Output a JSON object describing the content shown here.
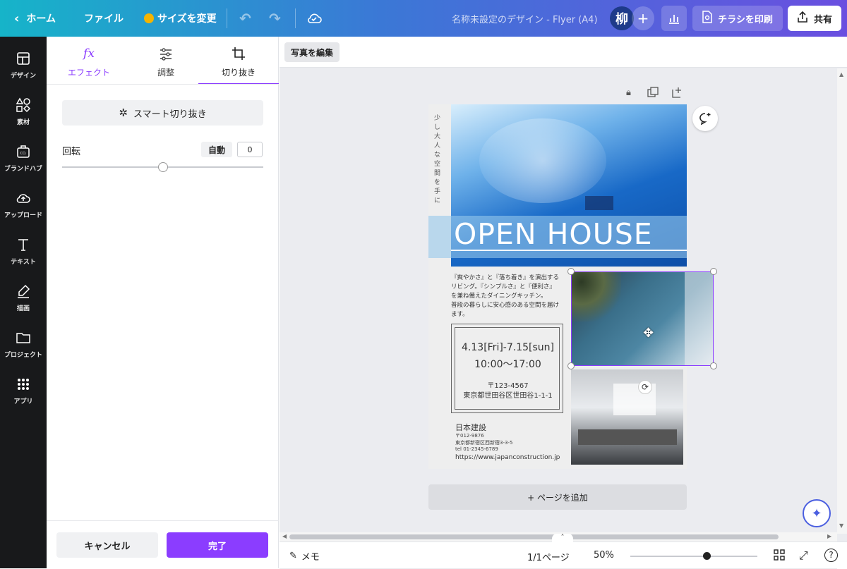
{
  "topbar": {
    "home": "ホーム",
    "file": "ファイル",
    "resize": "サイズを変更",
    "doc_title": "名称未設定のデザイン - Flyer (A4)",
    "avatar_initial": "柳",
    "print_label": "チラシを印刷",
    "share_label": "共有"
  },
  "leftnav": {
    "items": [
      {
        "label": "デザイン"
      },
      {
        "label": "素材"
      },
      {
        "label": "ブランドハブ"
      },
      {
        "label": "アップロード"
      },
      {
        "label": "テキスト"
      },
      {
        "label": "描画"
      },
      {
        "label": "プロジェクト"
      },
      {
        "label": "アプリ"
      }
    ]
  },
  "panel": {
    "tabs": [
      {
        "icon_text": "fx",
        "label": "エフェクト"
      },
      {
        "label": "調整"
      },
      {
        "label": "切り抜き"
      }
    ],
    "smart_crop": "スマート切り抜き",
    "rotation_label": "回転",
    "auto_label": "自動",
    "rotation_value": "0",
    "rotation_slider_fraction": 0.5,
    "cancel": "キャンセル",
    "done": "完了"
  },
  "workspace": {
    "edit_photo": "写真を編集",
    "add_page": "+ ページを追加",
    "memo": "メモ",
    "page_count": "1/1ページ",
    "zoom": "50%",
    "zoom_slider_fraction": 0.4
  },
  "flyer": {
    "vertical_text": "少し大人な空間を手に",
    "headline": "OPEN HOUSE",
    "body": [
      "『爽やかさ』と『落ち着き』を演出する",
      "リビング。『シンプルさ』と『便利さ』",
      "を兼ね備えたダイニングキッチン。",
      "普段の暮らしに安心感のある空間を届け",
      "ます。"
    ],
    "dates": "4.13[Fri]-7.15[sun]",
    "hours": "10:00〜17:00",
    "postal": "〒123-4567",
    "address": "東京都世田谷区世田谷1-1-1",
    "company": "日本建設",
    "company_postal": "〒012-9876",
    "company_address": "東京都新宿区西新宿3-3-5",
    "tel": "tel 01-2345-6789",
    "url": "https://www.japanconstruction.jp"
  },
  "colors": {
    "accent": "#8b3dff",
    "nav_bg": "#18191b",
    "header_start": "#16b4c9",
    "header_end": "#6a4fe0"
  }
}
